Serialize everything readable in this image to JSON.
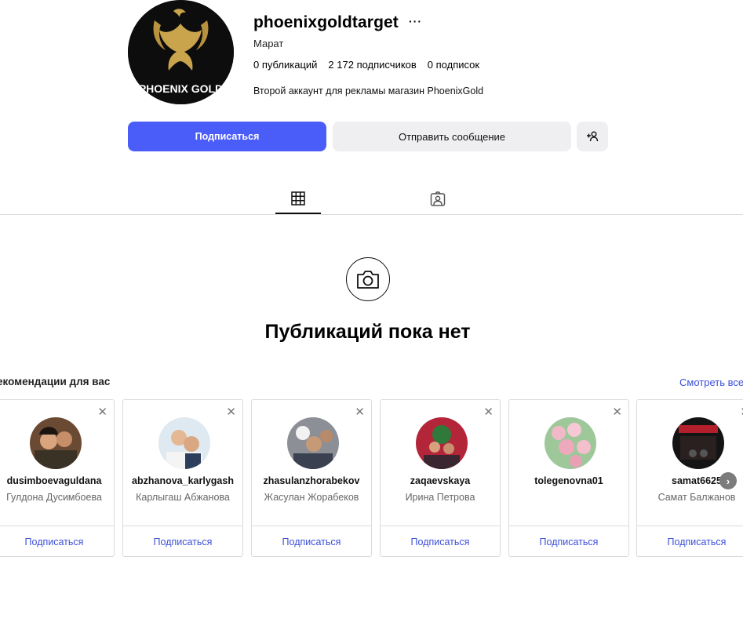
{
  "profile": {
    "username": "phoenixgoldtarget",
    "more_label": "···",
    "full_name": "Марат",
    "stats": {
      "posts": "0 публикаций",
      "followers": "2 172 подписчиков",
      "following": "0 подписок"
    },
    "bio": "Второй аккаунт для рекламы магазин PhoenixGold",
    "avatar_logo_text": "PHOENIX GOLD",
    "follow_label": "Подписаться",
    "message_label": "Отправить сообщение"
  },
  "tabs": {
    "posts_icon": "grid-icon",
    "tagged_icon": "tagged-person-icon"
  },
  "empty_state": {
    "title": "Публикаций пока нет",
    "icon": "camera-icon"
  },
  "recommendations": {
    "heading": "екомендации для вас",
    "see_all": "Смотреть все",
    "follow_label": "Подписаться",
    "cards": [
      {
        "username": "dusimboevaguldana",
        "name": "Гулдона Дусимбоева"
      },
      {
        "username": "abzhanova_karlygash",
        "name": "Карлыгаш Абжанова"
      },
      {
        "username": "zhasulanzhorabekov",
        "name": "Жасулан Жорабеков"
      },
      {
        "username": "zaqaevskaya",
        "name": "Ирина Петрова"
      },
      {
        "username": "tolegenovna01",
        "name": ""
      },
      {
        "username": "samat6625",
        "name": "Самат Балжанов"
      }
    ]
  },
  "colors": {
    "accent": "#4a5df9",
    "link": "#3b4fd8",
    "gold": "#c9a44c"
  }
}
